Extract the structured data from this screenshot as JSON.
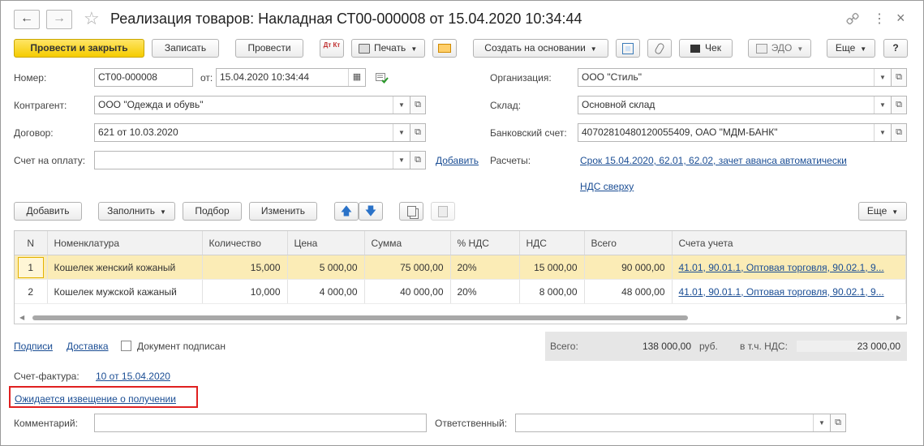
{
  "window": {
    "title": "Реализация товаров: Накладная СТ00-000008 от 15.04.2020 10:34:44"
  },
  "titlebar": {
    "back": "←",
    "forward": "→",
    "star": "☆",
    "link": "🔗",
    "more": "⋮",
    "close": "×"
  },
  "toolbar": {
    "post_close": "Провести и закрыть",
    "save": "Записать",
    "post": "Провести",
    "dtkt": "Дт Кт",
    "print": "Печать",
    "create_based": "Создать на основании",
    "check": "Чек",
    "edo": "ЭДО",
    "more": "Еще",
    "help": "?"
  },
  "form": {
    "number_label": "Номер:",
    "number_value": "СТ00-000008",
    "from_label": "от:",
    "date_value": "15.04.2020 10:34:44",
    "counterparty_label": "Контрагент:",
    "counterparty_value": "ООО \"Одежда и обувь\"",
    "contract_label": "Договор:",
    "contract_value": "621 от 10.03.2020",
    "invoice_label": "Счет на оплату:",
    "invoice_value": "",
    "add_link": "Добавить",
    "org_label": "Организация:",
    "org_value": "ООО \"Стиль\"",
    "warehouse_label": "Склад:",
    "warehouse_value": "Основной склад",
    "bank_label": "Банковский счет:",
    "bank_value": "40702810480120055409, ОАО \"МДМ-БАНК\"",
    "settlements_label": "Расчеты:",
    "settlements_link": "Срок 15.04.2020, 62.01, 62.02, зачет аванса автоматически",
    "vat_link": "НДС сверху"
  },
  "table_toolbar": {
    "add": "Добавить",
    "fill": "Заполнить",
    "pick": "Подбор",
    "change": "Изменить",
    "more": "Еще"
  },
  "table": {
    "columns": [
      "N",
      "Номенклатура",
      "Количество",
      "Цена",
      "Сумма",
      "% НДС",
      "НДС",
      "Всего",
      "Счета учета"
    ],
    "rows": [
      {
        "n": "1",
        "item": "Кошелек женский кожаный",
        "qty": "15,000",
        "price": "5 000,00",
        "sum": "75 000,00",
        "vat_rate": "20%",
        "vat": "15 000,00",
        "total": "90 000,00",
        "accounts": "41.01, 90.01.1, Оптовая торговля, 90.02.1, 9..."
      },
      {
        "n": "2",
        "item": "Кошелек мужской кажаный",
        "qty": "10,000",
        "price": "4 000,00",
        "sum": "40 000,00",
        "vat_rate": "20%",
        "vat": "8 000,00",
        "total": "48 000,00",
        "accounts": "41.01, 90.01.1, Оптовая торговля, 90.02.1, 9..."
      }
    ]
  },
  "footer": {
    "signatures_link": "Подписи",
    "delivery_link": "Доставка",
    "signed_label": "Документ подписан",
    "total_label": "Всего:",
    "total_value": "138 000,00",
    "currency": "руб.",
    "incl_vat_label": "в т.ч. НДС:",
    "incl_vat_value": "23 000,00",
    "sf_label": "Счет-фактура:",
    "sf_link": "10 от 15.04.2020",
    "notice_link": "Ожидается извещение о получении",
    "comment_label": "Комментарий:",
    "responsible_label": "Ответственный:",
    "comment_value": "",
    "responsible_value": ""
  }
}
